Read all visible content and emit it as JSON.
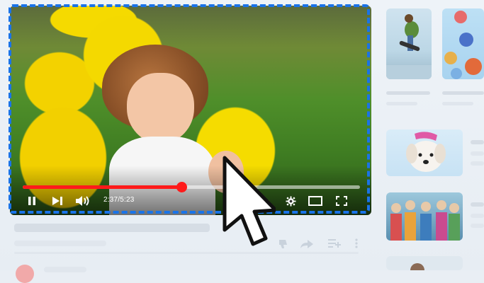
{
  "player": {
    "time_display": "2:37/5:23",
    "progress_fraction": 0.47,
    "accent_color": "#ff1a1a",
    "focus_outline_color": "#1a73e8",
    "icons": [
      "pause-icon",
      "next-icon",
      "volume-icon",
      "settings-gear-icon",
      "theater-mode-icon",
      "fullscreen-icon"
    ]
  },
  "below_video": {
    "action_icons": [
      "dislike-icon",
      "share-icon",
      "add-to-playlist-icon",
      "more-options-icon"
    ]
  },
  "sidebar": {
    "thumbnails": [
      "skateboarder-thumbnail",
      "balloons-thumbnail",
      "puppy-thumbnail",
      "crowd-thumbnail",
      "partial-thumbnail"
    ]
  }
}
